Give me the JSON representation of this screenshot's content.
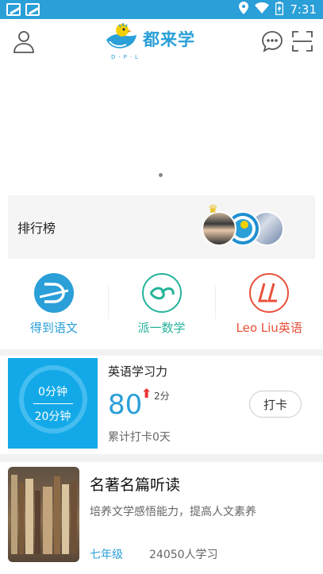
{
  "status_bar": {
    "time": "7:31"
  },
  "header": {
    "app_name": "都来学",
    "brand_sub": "D·P·L"
  },
  "leaderboard": {
    "title": "排行榜"
  },
  "apps": [
    {
      "label": "得到语文",
      "color": "#2a9fd8"
    },
    {
      "label": "派一数学",
      "color": "#24b39a"
    },
    {
      "label": "Leo Liu英语",
      "color": "#e8503a"
    }
  ],
  "study": {
    "title": "英语学习力",
    "done": "0分钟",
    "goal": "20分钟",
    "score": "80",
    "delta": "2分",
    "streak": "累计打卡0天",
    "checkin": "打卡"
  },
  "course": {
    "title": "名著名篇听读",
    "desc": "培养文学感悟能力，提高人文素养",
    "grade": "七年级",
    "count": "24050人学习"
  },
  "colors": {
    "brand": "#2a9fd8",
    "timer_bg": "#13a9e8",
    "up_arrow": "#e33333"
  }
}
